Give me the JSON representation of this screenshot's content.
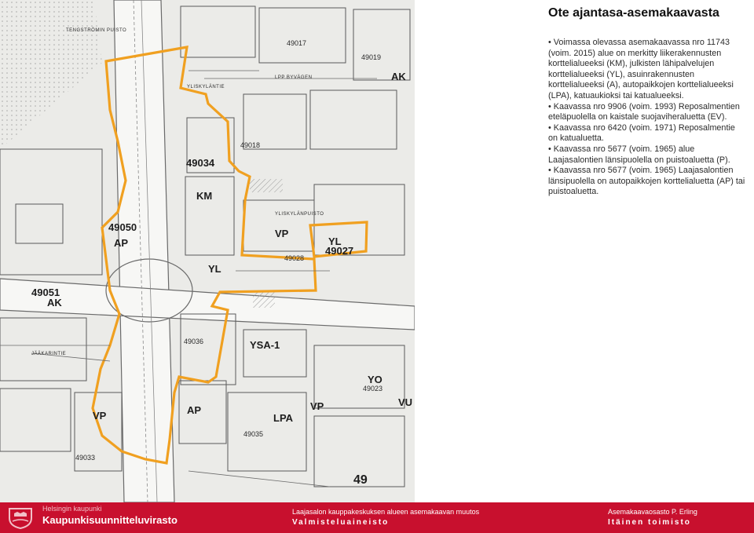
{
  "panel": {
    "title": "Ote ajantasa-asemakaavasta",
    "paragraphs": [
      {
        "bullet": true,
        "text": "Voimassa olevassa asemakaavassa nro 11743 (voim. 2015) alue on merkitty liikerakennusten korttelialueeksi (KM), julkisten lähipalvelujen korttelialueeksi (YL), asuinrakennusten korttelialueeksi (A), autopaikkojen korttelialueeksi (LPA), katuaukioksi tai katualueeksi."
      },
      {
        "bullet": true,
        "text": "Kaavassa nro 9906 (voim. 1993) Reposalmentien eteläpuolella on kaistale suojaviheraluetta (EV)."
      },
      {
        "bullet": true,
        "text": "Kaavassa nro 6420 (voim. 1971) Reposalmentie on katualuetta."
      },
      {
        "bullet": true,
        "text": "Kaavassa nro 5677 (voim. 1965) alue Laajasalontien länsipuolella on puistoaluetta (P)."
      },
      {
        "bullet": true,
        "text": "Kaavassa nro 5677 (voim. 1965) Laajasalontien länsipuolella on autopaikkojen korttelialuetta (AP) tai puistoaluetta."
      }
    ]
  },
  "map": {
    "labels": {
      "block_49034": "49034",
      "block_49050": "49050",
      "block_49027": "49027",
      "block_49028": "49028",
      "block_49051": "49051",
      "block_49036": "49036",
      "block_49035": "49035",
      "block_49033": "49033",
      "block_49023": "49023",
      "block_49017": "49017",
      "block_49019": "49019",
      "block_49018": "49018",
      "code_km": "KM",
      "code_yl": "YL",
      "code_vp": "VP",
      "code_ap": "AP",
      "code_ak": "AK",
      "code_lpa": "LPA",
      "code_vu": "VU",
      "code_yo": "YO",
      "code_ysa": "YSA-1",
      "code_ap2": "AP",
      "code_vp2": "VP",
      "code_yl2": "YL",
      "code_vp3": "VP",
      "code_ak2": "AK",
      "page_num": "49",
      "street_yliskyla": "YLISKYLÄNTIE",
      "street_lpp": "LPP BYVÄGEN",
      "street_yliskylan": "YLISKYLÄNPUISTO",
      "street_jaakarintie": "JÄÄKARINTIE",
      "street_tenccinpuisto": "TENGSTRÖMIN PUISTO"
    },
    "boundary_color": "#f0a020"
  },
  "footer": {
    "org_top": "Helsingin kaupunki",
    "org_name": "Kaupunkisuunnitteluvirasto",
    "title_line1": "Laajasalon kauppakeskuksen alueen asemakaavan muutos",
    "title_line2": "Valmisteluaineisto",
    "author_line1": "Asemakaavaosasto P. Erling",
    "author_line2": "Itäinen toimisto",
    "bg_color": "#c8102e"
  }
}
